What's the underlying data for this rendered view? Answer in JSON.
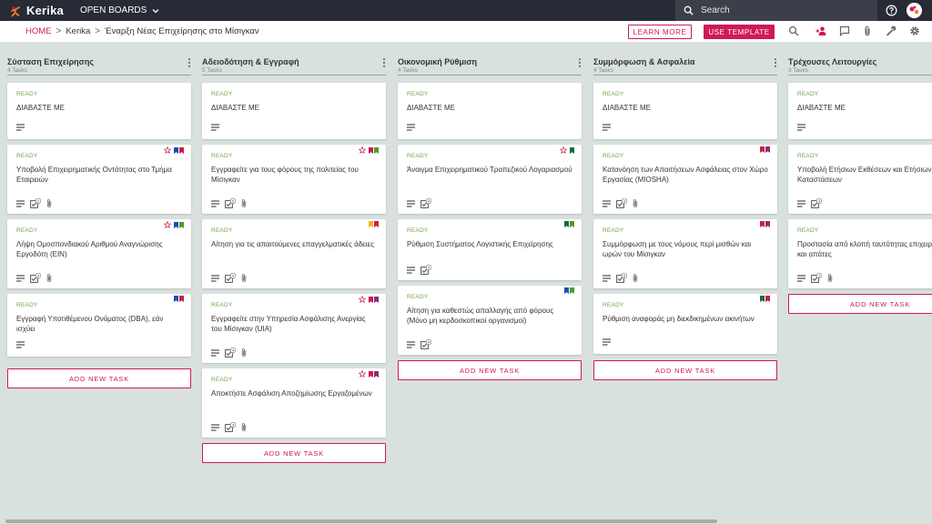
{
  "app": {
    "name": "Kerika",
    "open_boards_label": "OPEN BOARDS"
  },
  "search": {
    "placeholder": "Search"
  },
  "breadcrumb": {
    "home": "HOME",
    "org": "Kerika",
    "board": "Έναρξη Νέας Επιχείρησης στο Μίσιγκαν",
    "separator": ">"
  },
  "toolbar": {
    "learn_more": "LEARN MORE",
    "use_template": "USE TEMPLATE"
  },
  "colors": {
    "accent": "#d0185b",
    "status_green": "#6ea54a",
    "topbar": "#262b36",
    "board_bg": "#d9e1de"
  },
  "columns": [
    {
      "title": "Σύσταση Επιχείρησης",
      "count": "4 Tasks",
      "add_label": "ADD NEW TASK",
      "cards": [
        {
          "status": "READY",
          "title": "ΔΙΑΒΑΣΤΕ ΜΕ",
          "star": false,
          "flags": [],
          "icons": [
            "description-icon"
          ]
        },
        {
          "status": "READY",
          "title": "Υποβολή Επιχειρηματικής Οντότητας στο Τμήμα Εταιρειών",
          "star": true,
          "flags": [
            "#1a4fb5",
            "#c81e4a"
          ],
          "icons": [
            "description-icon",
            "checklist-icon",
            "attachment-icon"
          ],
          "checklist_count": "2"
        },
        {
          "status": "READY",
          "title": "Λήψη Ομοσπονδιακού Αριθμού Αναγνώρισης Εργοδότη (EIN)",
          "star": true,
          "flags": [
            "#1a4fb5",
            "#4c9a2a"
          ],
          "icons": [
            "description-icon",
            "checklist-icon",
            "attachment-icon"
          ],
          "checklist_count": "4"
        },
        {
          "status": "READY",
          "title": "Εγγραφή Υποτιθέμενου Ονόματος (DBA), εάν ισχύει",
          "star": false,
          "flags": [
            "#1a4fb5",
            "#c81e4a"
          ],
          "icons": [
            "description-icon"
          ]
        }
      ]
    },
    {
      "title": "Αδειοδότηση & Εγγραφή",
      "count": "5 Tasks",
      "add_label": "ADD NEW TASK",
      "cards": [
        {
          "status": "READY",
          "title": "ΔΙΑΒΑΣΤΕ ΜΕ",
          "star": false,
          "flags": [],
          "icons": [
            "description-icon"
          ]
        },
        {
          "status": "READY",
          "title": "Εγγραφείτε για τους φόρους της πολιτείας του Μίσιγκαν",
          "star": true,
          "flags": [
            "#c81e4a",
            "#4c9a2a"
          ],
          "icons": [
            "description-icon",
            "checklist-icon",
            "attachment-icon"
          ],
          "checklist_count": "5"
        },
        {
          "status": "READY",
          "title": "Αίτηση για τις απαιτούμενες επαγγελματικές άδειες",
          "star": false,
          "flags": [
            "#f3b21b",
            "#c81e4a"
          ],
          "icons": [
            "description-icon",
            "checklist-icon",
            "attachment-icon"
          ],
          "checklist_count": "4"
        },
        {
          "status": "READY",
          "title": "Εγγραφείτε στην Υπηρεσία Ασφάλισης Ανεργίας του Μίσιγκαν (UIA)",
          "star": true,
          "flags": [
            "#c81e4a",
            "#8e2a7a"
          ],
          "icons": [
            "description-icon",
            "checklist-icon",
            "attachment-icon"
          ],
          "checklist_count": "4"
        },
        {
          "status": "READY",
          "title": "Αποκτήστε Ασφάλιση Αποζημίωσης Εργαζομένων",
          "star": true,
          "flags": [
            "#c81e4a",
            "#8e2a7a"
          ],
          "icons": [
            "description-icon",
            "checklist-icon",
            "attachment-icon"
          ],
          "checklist_count": "3"
        }
      ]
    },
    {
      "title": "Οικονομική Ρύθμιση",
      "count": "4 Tasks",
      "add_label": "ADD NEW TASK",
      "cards": [
        {
          "status": "READY",
          "title": "ΔΙΑΒΑΣΤΕ ΜΕ",
          "star": false,
          "flags": [],
          "icons": [
            "description-icon"
          ]
        },
        {
          "status": "READY",
          "title": "Άνοιγμα Επιχειρηματικού Τραπεζικού Λογαριασμού",
          "star": true,
          "flags": [
            "#1b6b3a"
          ],
          "icons": [
            "description-icon",
            "checklist-icon"
          ],
          "checklist_count": "4"
        },
        {
          "status": "READY",
          "title": "Ρύθμιση Συστήματος Λογιστικής Επιχείρησης",
          "star": false,
          "flags": [
            "#1b6b3a",
            "#4c9a2a"
          ],
          "icons": [
            "description-icon",
            "checklist-icon"
          ],
          "checklist_count": "4"
        },
        {
          "status": "READY",
          "title": "Αίτηση για καθεστώς απαλλαγής από φόρους (Μόνο μη κερδοσκοπικοί οργανισμοί)",
          "star": false,
          "flags": [
            "#1a4fb5",
            "#4c9a2a"
          ],
          "icons": [
            "description-icon",
            "checklist-icon"
          ],
          "checklist_count": "4"
        }
      ]
    },
    {
      "title": "Συμμόρφωση & Ασφαλεία",
      "count": "4 Tasks",
      "add_label": "ADD NEW TASK",
      "cards": [
        {
          "status": "READY",
          "title": "ΔΙΑΒΑΣΤΕ ΜΕ",
          "star": false,
          "flags": [],
          "icons": [
            "description-icon"
          ]
        },
        {
          "status": "READY",
          "title": "Κατανόηση των Απαιτήσεων Ασφάλειας στον Χώρο Εργασίας (MIOSHA)",
          "star": false,
          "flags": [
            "#c81e4a",
            "#8e2a7a"
          ],
          "icons": [
            "description-icon",
            "checklist-icon",
            "attachment-icon"
          ],
          "checklist_count": "4"
        },
        {
          "status": "READY",
          "title": "Συμμόρφωση με τους νόμους περί μισθών και ωρών του Μίσιγκαν",
          "star": false,
          "flags": [
            "#c81e4a",
            "#8e2a7a"
          ],
          "icons": [
            "description-icon",
            "checklist-icon",
            "attachment-icon"
          ],
          "checklist_count": "4"
        },
        {
          "status": "READY",
          "title": "Ρύθμιση αναφοράς μη διεκδικημένων ακινήτων",
          "star": false,
          "flags": [
            "#1b6b3a",
            "#c81e4a"
          ],
          "icons": [
            "description-icon"
          ]
        }
      ]
    },
    {
      "title": "Τρέχουσες Λειτουργίες",
      "count": "3 Tasks",
      "add_label": "ADD NEW TASK",
      "cards": [
        {
          "status": "READY",
          "title": "ΔΙΑΒΑΣΤΕ ΜΕ",
          "star": false,
          "flags": [],
          "icons": [
            "description-icon"
          ]
        },
        {
          "status": "READY",
          "title": "Υποβολή Ετήσιων Εκθέσεων και Ετήσιων Καταστάσεων",
          "star": false,
          "flags": [],
          "icons": [
            "description-icon",
            "checklist-icon"
          ],
          "checklist_count": "4"
        },
        {
          "status": "READY",
          "title": "Προστασία από κλοπή ταυτότητας επιχειρήσεων και απάτες",
          "star": false,
          "flags": [],
          "icons": [
            "description-icon",
            "checklist-icon",
            "attachment-icon"
          ],
          "checklist_count": "3"
        }
      ]
    }
  ]
}
